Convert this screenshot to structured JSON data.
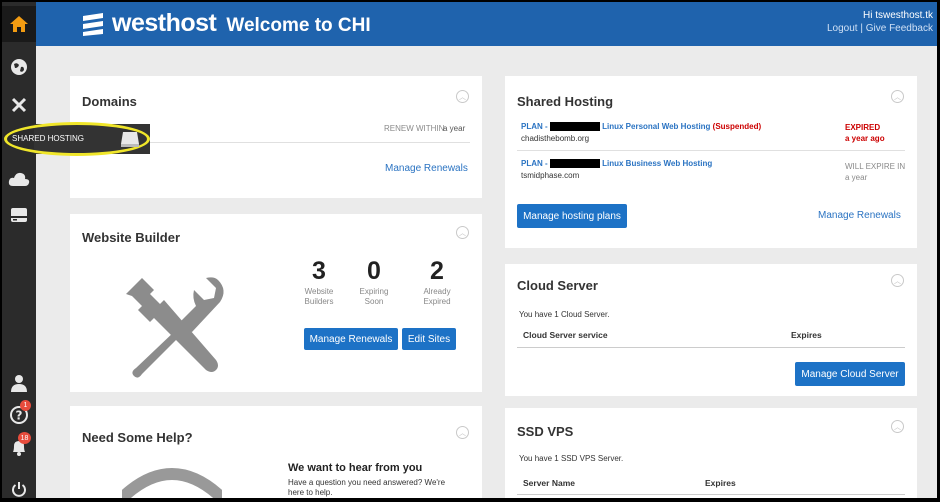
{
  "header": {
    "brand": "westhost",
    "welcome": "Welcome to CHI",
    "greeting": "Hi tswesthost.tk",
    "logout": "Logout",
    "separator": "|",
    "feedback": "Give Feedback"
  },
  "sidebar": {
    "tooltip": "SHARED HOSTING",
    "badge_help": "1",
    "badge_alerts": "18",
    "icons": [
      "home-icon",
      "globe-icon",
      "tools-icon",
      "server-icon",
      "cloud-icon",
      "server-icon",
      "user-icon",
      "help-icon",
      "bell-icon",
      "power-icon"
    ]
  },
  "domains": {
    "title": "Domains",
    "renew_within": "RENEW WITHIN",
    "renew_value": "a year",
    "manage_renewals": "Manage Renewals"
  },
  "website_builder": {
    "title": "Website Builder",
    "stats": [
      {
        "value": "3",
        "label_1": "Website",
        "label_2": "Builders"
      },
      {
        "value": "0",
        "label_1": "Expiring",
        "label_2": "Soon"
      },
      {
        "value": "2",
        "label_1": "Already",
        "label_2": "Expired"
      }
    ],
    "manage_renewals": "Manage Renewals",
    "edit_sites": "Edit Sites"
  },
  "help": {
    "title": "Need Some Help?",
    "heading": "We want to hear from you",
    "body_1": "Have a question you need answered? We're",
    "body_2": "here to help."
  },
  "shared_hosting": {
    "title": "Shared Hosting",
    "plans": [
      {
        "prefix": "PLAN - ",
        "name": "Linux Personal Web Hosting",
        "status": "(Suspended)",
        "domain": "chadisthebomb.org",
        "state": "EXPIRED",
        "when": "a year ago"
      },
      {
        "prefix": "PLAN - ",
        "name": "Linux Business Web Hosting",
        "status": "",
        "domain": "tsmidphase.com",
        "state": "WILL EXPIRE IN",
        "when": "a year"
      }
    ],
    "manage_plans": "Manage hosting plans",
    "manage_renewals": "Manage Renewals"
  },
  "cloud_server": {
    "title": "Cloud Server",
    "summary": "You have 1 Cloud Server.",
    "col_service": "Cloud Server service",
    "col_expires": "Expires",
    "manage": "Manage Cloud Server"
  },
  "ssd_vps": {
    "title": "SSD VPS",
    "summary": "You have 1 SSD VPS Server.",
    "col_name": "Server Name",
    "col_expires": "Expires"
  },
  "colors": {
    "header": "#1f63ad",
    "sidebar": "#2b2b2b",
    "home": "#f39c12",
    "button": "#1d72c6",
    "link": "#2a73c2",
    "expired": "#cc0000",
    "tooltip_highlight": "#f0e62a"
  }
}
